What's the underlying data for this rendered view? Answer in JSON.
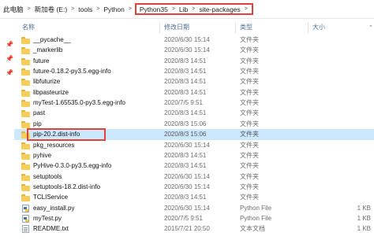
{
  "breadcrumb": {
    "items": [
      "此电脑",
      "新加卷 (E:)",
      "tools",
      "Python"
    ],
    "highlighted": [
      "Python35",
      "Lib",
      "site-packages"
    ],
    "highlight_color": "#e0433b"
  },
  "columns": {
    "name": "名称",
    "date": "修改日期",
    "type": "类型",
    "size": "大小"
  },
  "files": [
    {
      "name": "__pycache__",
      "date": "2020/6/30 15:14",
      "type": "文件夹",
      "size": "",
      "icon": "folder-icon"
    },
    {
      "name": "_markerlib",
      "date": "2020/6/30 15:14",
      "type": "文件夹",
      "size": "",
      "icon": "folder-icon"
    },
    {
      "name": "future",
      "date": "2020/8/3 14:51",
      "type": "文件夹",
      "size": "",
      "icon": "folder-icon"
    },
    {
      "name": "future-0.18.2-py3.5.egg-info",
      "date": "2020/8/3 14:51",
      "type": "文件夹",
      "size": "",
      "icon": "folder-icon"
    },
    {
      "name": "libfuturize",
      "date": "2020/8/3 14:51",
      "type": "文件夹",
      "size": "",
      "icon": "folder-icon"
    },
    {
      "name": "libpasteurize",
      "date": "2020/8/3 14:51",
      "type": "文件夹",
      "size": "",
      "icon": "folder-icon"
    },
    {
      "name": "myTest-1.65535.0-py3.5.egg-info",
      "date": "2020/7/5 9:51",
      "type": "文件夹",
      "size": "",
      "icon": "folder-icon"
    },
    {
      "name": "past",
      "date": "2020/8/3 14:51",
      "type": "文件夹",
      "size": "",
      "icon": "folder-icon"
    },
    {
      "name": "pip",
      "date": "2020/8/3 15:06",
      "type": "文件夹",
      "size": "",
      "icon": "folder-icon"
    },
    {
      "name": "pip-20.2.dist-info",
      "date": "2020/8/3 15:06",
      "type": "文件夹",
      "size": "",
      "icon": "folder-icon",
      "selected": true
    },
    {
      "name": "pkg_resources",
      "date": "2020/6/30 15:14",
      "type": "文件夹",
      "size": "",
      "icon": "folder-icon"
    },
    {
      "name": "pyhive",
      "date": "2020/8/3 14:51",
      "type": "文件夹",
      "size": "",
      "icon": "folder-icon"
    },
    {
      "name": "PyHive-0.3.0-py3.5.egg-info",
      "date": "2020/8/3 14:51",
      "type": "文件夹",
      "size": "",
      "icon": "folder-icon"
    },
    {
      "name": "setuptools",
      "date": "2020/6/30 15:14",
      "type": "文件夹",
      "size": "",
      "icon": "folder-icon"
    },
    {
      "name": "setuptools-18.2.dist-info",
      "date": "2020/6/30 15:14",
      "type": "文件夹",
      "size": "",
      "icon": "folder-icon"
    },
    {
      "name": "TCLIService",
      "date": "2020/8/3 14:51",
      "type": "文件夹",
      "size": "",
      "icon": "folder-icon"
    },
    {
      "name": "easy_install.py",
      "date": "2020/6/30 15:14",
      "type": "Python File",
      "size": "1 KB",
      "icon": "python-file-icon"
    },
    {
      "name": "myTest.py",
      "date": "2020/7/5 9:51",
      "type": "Python File",
      "size": "1 KB",
      "icon": "python-file-icon"
    },
    {
      "name": "README.txt",
      "date": "2015/7/21 20:50",
      "type": "文本文档",
      "size": "1 KB",
      "icon": "text-file-icon"
    }
  ],
  "selection_color": "#cce8ff"
}
